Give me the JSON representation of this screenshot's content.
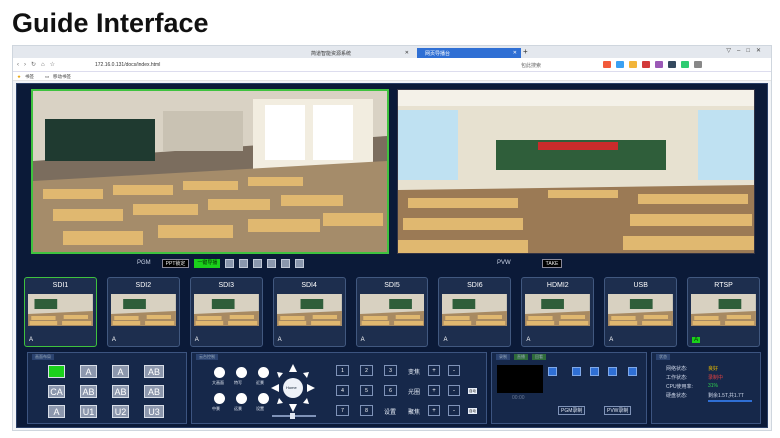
{
  "slide": {
    "title": "Guide Interface"
  },
  "browser": {
    "tabs": [
      {
        "label": "简道智能资源系统"
      },
      {
        "label": "网页导播台"
      }
    ],
    "url": "172.16.0.131/docs/index.html",
    "search_label": "包此搜索",
    "bookmarks": [
      "书签",
      "移动书签"
    ]
  },
  "colors": {
    "app_bg": "#0b1a38",
    "active_green": "#1bd11b",
    "panel_bg": "#16284a"
  },
  "monitors": {
    "pgm": {
      "label": "PGM",
      "ppt_lock": "PPT锁定",
      "one_key": "一键导播"
    },
    "pvw": {
      "label": "PVW",
      "take": "TAKE"
    }
  },
  "sources": [
    {
      "name": "SDI1",
      "flag": "A",
      "active": true
    },
    {
      "name": "SDI2",
      "flag": "A",
      "active": false
    },
    {
      "name": "SDI3",
      "flag": "A",
      "active": false
    },
    {
      "name": "SDI4",
      "flag": "A",
      "active": false
    },
    {
      "name": "SDI5",
      "flag": "A",
      "active": false
    },
    {
      "name": "SDI6",
      "flag": "A",
      "active": false
    },
    {
      "name": "HDMI2",
      "flag": "A",
      "active": false
    },
    {
      "name": "USB",
      "flag": "A",
      "active": false
    },
    {
      "name": "RTSP",
      "flag": "A",
      "active": true
    }
  ],
  "layout_panel": {
    "tag": "画面布局",
    "keys": [
      [
        "",
        "A",
        "A",
        "AB"
      ],
      [
        "CA",
        "AB",
        "AB",
        "AB"
      ],
      [
        "A",
        "U1",
        "U2",
        "U3"
      ]
    ]
  },
  "ptz_panel": {
    "tag": "云台控制",
    "presets": [
      {
        "label": "大画面",
        "icon": "person-icon"
      },
      {
        "label": "特写",
        "icon": "person-icon"
      },
      {
        "label": "近景",
        "icon": "person-icon"
      },
      {
        "label": "中景",
        "icon": "group-icon"
      },
      {
        "label": "远景",
        "icon": "group-icon"
      },
      {
        "label": "设置",
        "icon": "settings"
      }
    ],
    "dpad_center": "Home",
    "numbers": [
      "1",
      "2",
      "3",
      "4",
      "5",
      "6",
      "7",
      "8"
    ],
    "zoom": {
      "label": "变焦",
      "plus": "+",
      "minus": "-"
    },
    "iris": {
      "label": "光圈",
      "plus": "+",
      "minus": "-",
      "auto": "自动"
    },
    "focus": {
      "label": "聚焦",
      "plus": "+",
      "minus": "-",
      "auto": "自动"
    },
    "settings": "设置"
  },
  "record_panel": {
    "tags": [
      "录制",
      "直播",
      "回看"
    ],
    "timer": "00:00",
    "pgm_record": "PGM录制",
    "pvw_record": "PVW录制"
  },
  "status_panel": {
    "tag": "状态",
    "network": {
      "label": "网络状态:",
      "value": "良好"
    },
    "work": {
      "label": "工作状态:",
      "value": "录制中"
    },
    "cpu": {
      "label": "CPU使用率:",
      "value": "31%"
    },
    "disk": {
      "label": "硬盘状态:",
      "value": "剩余1.5T,共1.7T"
    }
  }
}
